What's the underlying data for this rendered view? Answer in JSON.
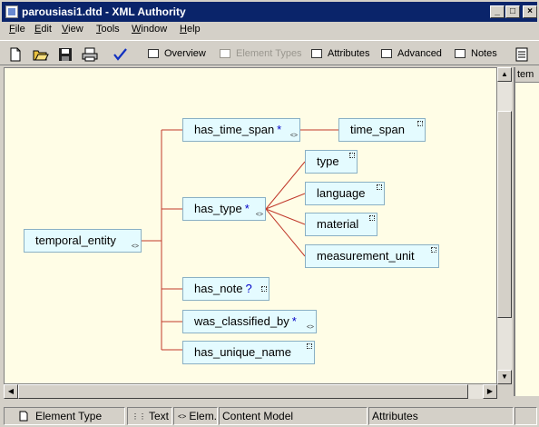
{
  "window": {
    "title": "parousiasi1.dtd - XML Authority",
    "minimize_glyph": "_",
    "maximize_glyph": "□",
    "close_glyph": "×"
  },
  "menu": [
    {
      "label": "File",
      "underline": "F",
      "rest": "ile"
    },
    {
      "label": "Edit",
      "underline": "E",
      "rest": "dit"
    },
    {
      "label": "View",
      "underline": "V",
      "rest": "iew"
    },
    {
      "label": "Tools",
      "underline": "T",
      "rest": "ools"
    },
    {
      "label": "Window",
      "underline": "W",
      "rest": "indow"
    },
    {
      "label": "Help",
      "underline": "H",
      "rest": "elp"
    }
  ],
  "toolbar": {
    "overview": "Overview",
    "element_types": "Element Types",
    "attributes": "Attributes",
    "advanced": "Advanced",
    "notes": "Notes"
  },
  "tree": {
    "root": {
      "label": "temporal_entity",
      "cardinality": ""
    },
    "children": [
      {
        "label": "has_time_span",
        "cardinality": "*"
      },
      {
        "label": "has_type",
        "cardinality": "*"
      },
      {
        "label": "has_note",
        "cardinality": "?"
      },
      {
        "label": "was_classified_by",
        "cardinality": "*"
      },
      {
        "label": "has_unique_name",
        "cardinality": ""
      }
    ],
    "time_span_children": [
      {
        "label": "time_span",
        "cardinality": ""
      }
    ],
    "type_children": [
      {
        "label": "type",
        "cardinality": ""
      },
      {
        "label": "language",
        "cardinality": ""
      },
      {
        "label": "material",
        "cardinality": ""
      },
      {
        "label": "measurement_unit",
        "cardinality": ""
      }
    ]
  },
  "right_pane": {
    "header": "tem"
  },
  "statusbar": {
    "element_type": "Element Type",
    "text": "Text",
    "elem": "Elem.",
    "content_model": "Content Model",
    "attributes": "Attributes"
  },
  "colors": {
    "canvas_bg": "#fffde6",
    "node_bg": "#e4fbff",
    "connector": "#c0392b",
    "cardinality": "#0000c8",
    "titlebar": "#0a246a"
  },
  "icons": [
    "document-icon",
    "new-file-icon",
    "open-folder-icon",
    "save-disk-icon",
    "print-icon",
    "checkmark-icon",
    "grid-icon",
    "attribute-icon",
    "advanced-icon",
    "note-icon"
  ]
}
